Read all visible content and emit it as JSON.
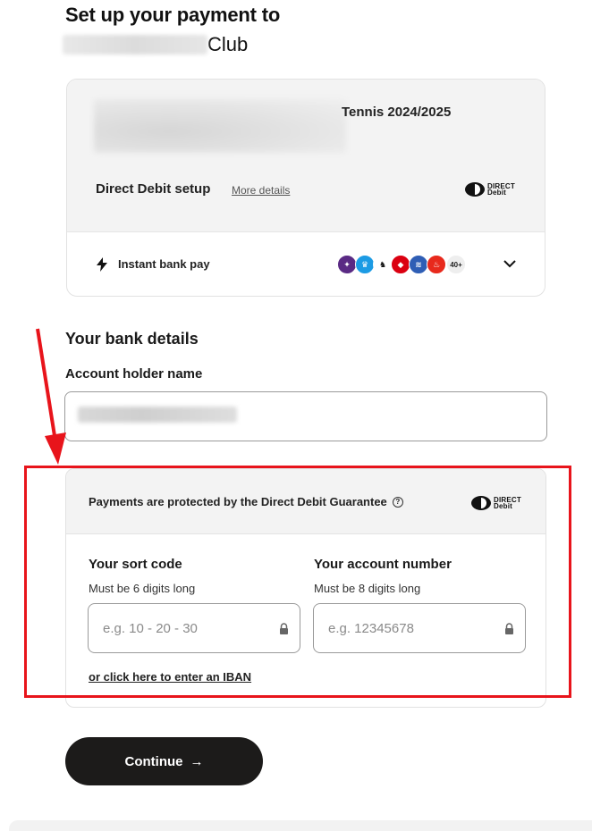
{
  "header": {
    "title": "Set up your payment to",
    "club_suffix": "Club"
  },
  "summary": {
    "product_name": "Tennis 2024/2025",
    "dd_setup_label": "Direct Debit setup",
    "more_details_link": "More details",
    "dd_logo_text_top": "DIRECT",
    "dd_logo_text_bottom": "Debit",
    "instant_label": "Instant bank pay",
    "banks_more": "40+",
    "bank_colors": [
      "#5a2a84",
      "#1c9be4",
      "#ffffff",
      "#db0011",
      "#2f5eb5",
      "#e8291c"
    ]
  },
  "bank_details": {
    "section_title": "Your bank details",
    "holder_label": "Account holder name"
  },
  "guarantee": {
    "text": "Payments are protected by the Direct Debit Guarantee",
    "q_icon": "?"
  },
  "sort_code": {
    "label": "Your sort code",
    "hint": "Must be 6 digits long",
    "placeholder": "e.g. 10 - 20 - 30"
  },
  "account_number": {
    "label": "Your account number",
    "hint": "Must be 8 digits long",
    "placeholder": "e.g. 12345678"
  },
  "iban_link": "or click here to enter an IBAN",
  "continue": {
    "label": "Continue",
    "arrow": "→"
  },
  "colors": {
    "highlight": "#e8141b",
    "button": "#1c1b1a",
    "card_bg": "#f3f3f3"
  }
}
